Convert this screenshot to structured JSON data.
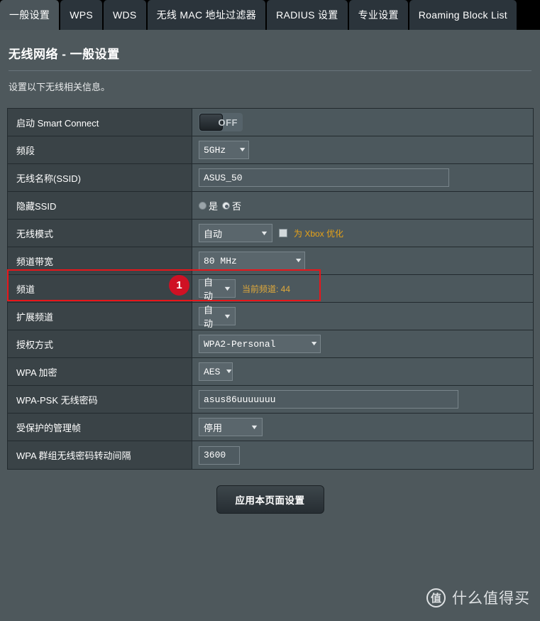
{
  "tabs": [
    {
      "label": "一般设置",
      "active": true
    },
    {
      "label": "WPS",
      "active": false
    },
    {
      "label": "WDS",
      "active": false
    },
    {
      "label": "无线 MAC 地址过滤器",
      "active": false
    },
    {
      "label": "RADIUS 设置",
      "active": false
    },
    {
      "label": "专业设置",
      "active": false
    },
    {
      "label": "Roaming Block List",
      "active": false
    }
  ],
  "page": {
    "title": "无线网络 - 一般设置",
    "description": "设置以下无线相关信息。"
  },
  "rows": {
    "smart_connect": {
      "label": "启动 Smart Connect",
      "toggle_state": "OFF"
    },
    "band": {
      "label": "频段",
      "value": "5GHz"
    },
    "ssid": {
      "label": "无线名称(SSID)",
      "value": "ASUS_50"
    },
    "hide_ssid": {
      "label": "隐藏SSID",
      "yes_label": "是",
      "no_label": "否",
      "selected": "否"
    },
    "wireless_mode": {
      "label": "无线模式",
      "value": "自动",
      "xbox_label": "为 Xbox 优化",
      "xbox_checked": false
    },
    "channel_bandwidth": {
      "label": "频道带宽",
      "value": "80 MHz",
      "badge": "1"
    },
    "channel": {
      "label": "频道",
      "value": "自动",
      "note": "当前频道: 44"
    },
    "ext_channel": {
      "label": "扩展频道",
      "value": "自动"
    },
    "auth_method": {
      "label": "授权方式",
      "value": "WPA2-Personal"
    },
    "wpa_encryption": {
      "label": "WPA 加密",
      "value": "AES"
    },
    "wpa_psk": {
      "label": "WPA-PSK 无线密码",
      "value": "asus86uuuuuuu"
    },
    "pmf": {
      "label": "受保护的管理帧",
      "value": "停用"
    },
    "group_key_rotation": {
      "label": "WPA 群组无线密码转动间隔",
      "value": "3600"
    }
  },
  "apply_button": {
    "label": "应用本页面设置"
  },
  "watermark": {
    "logo": "值",
    "text": "什么值得买"
  },
  "colors": {
    "accent_red": "#cf1124",
    "highlight_border": "#e8161a",
    "gold": "#e8a317",
    "page_bg": "#4e585c",
    "tabbar_bg": "#000000"
  }
}
